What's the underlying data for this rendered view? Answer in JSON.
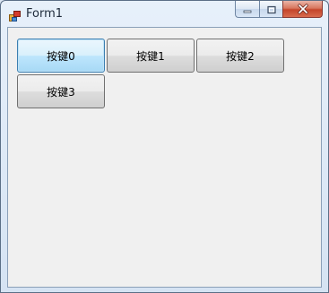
{
  "window": {
    "title": "Form1",
    "app_icon": "form-app-icon",
    "caption_buttons": {
      "minimize_icon": "minimize-icon",
      "maximize_icon": "maximize-icon",
      "close_icon": "close-icon"
    }
  },
  "buttons": [
    {
      "label": "按键0",
      "focused": true
    },
    {
      "label": "按键1",
      "focused": false
    },
    {
      "label": "按键2",
      "focused": false
    },
    {
      "label": "按键3",
      "focused": false
    }
  ],
  "colors": {
    "client_background": "#f0f0f0",
    "close_button": "#c4452a",
    "focus_border": "#3c7fb1"
  }
}
